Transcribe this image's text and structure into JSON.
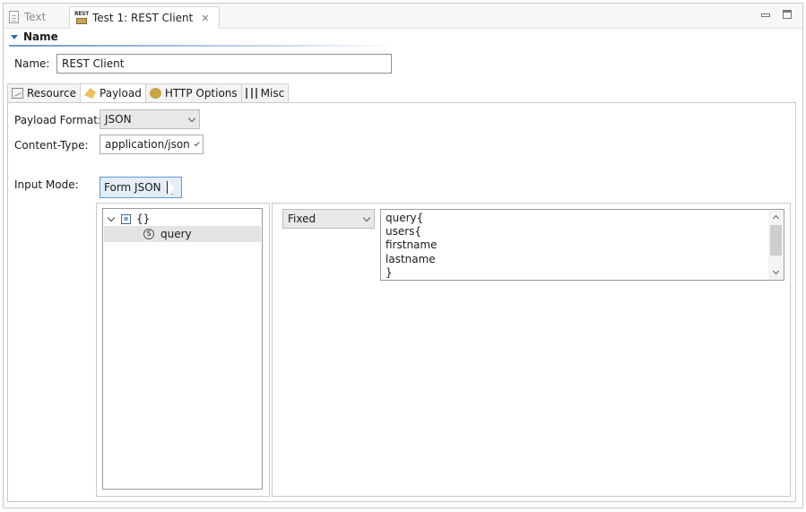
{
  "editor": {
    "tabs": [
      {
        "label": "Text",
        "active": false
      },
      {
        "label": "Test 1: REST Client",
        "active": true,
        "icon_text": "REST"
      }
    ]
  },
  "name_section": {
    "title": "Name",
    "name_label": "Name:",
    "name_value": "REST Client"
  },
  "inner_tabs": [
    {
      "label": "Resource",
      "icon": "resource-icon"
    },
    {
      "label": "Payload",
      "icon": "payload-icon",
      "active": true
    },
    {
      "label": "HTTP Options",
      "icon": "http-options-icon"
    },
    {
      "label": "Misc",
      "icon": "misc-icon"
    }
  ],
  "payload": {
    "format_label": "Payload Format:",
    "format_value": "JSON",
    "content_type_label": "Content-Type:",
    "content_type_value": "application/json",
    "input_mode_label": "Input Mode:",
    "input_mode_value": "Form JSON"
  },
  "tree": {
    "root": {
      "icon_text": "o",
      "label": "{}"
    },
    "children": [
      {
        "icon_text": "S",
        "label": "query",
        "selected": true
      }
    ]
  },
  "value_editor": {
    "mode": "Fixed",
    "lines": [
      "query{",
      "users{",
      "firstname",
      "lastname",
      "}"
    ]
  },
  "colors": {
    "accent": "#2f6db3",
    "selection": "#e4e4e4",
    "button_focus": "#e3eef9"
  }
}
